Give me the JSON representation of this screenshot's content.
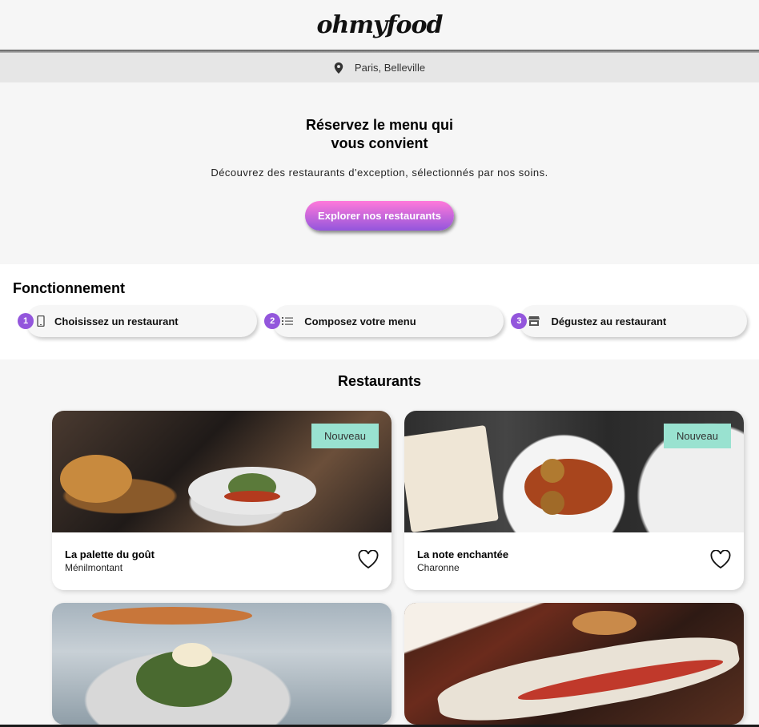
{
  "header": {
    "logo": "ohmyfood"
  },
  "location": {
    "text": "Paris, Belleville"
  },
  "hero": {
    "title_line1": "Réservez le menu qui",
    "title_line2": "vous convient",
    "subtitle": "Découvrez des restaurants d'exception, sélectionnés par nos soins.",
    "cta_label": "Explorer nos restaurants"
  },
  "how": {
    "title": "Fonctionnement",
    "steps": [
      {
        "number": "1",
        "icon": "mobile-phone-icon",
        "label": "Choisissez un restaurant"
      },
      {
        "number": "2",
        "icon": "list-icon",
        "label": "Composez votre menu"
      },
      {
        "number": "3",
        "icon": "store-icon",
        "label": "Dégustez au restaurant"
      }
    ]
  },
  "restaurants": {
    "title": "Restaurants",
    "items": [
      {
        "name": "La palette du goût",
        "area": "Ménilmontant",
        "badge": "Nouveau"
      },
      {
        "name": "La note enchantée",
        "area": "Charonne",
        "badge": "Nouveau"
      },
      {
        "name": "",
        "area": "",
        "badge": ""
      },
      {
        "name": "",
        "area": "",
        "badge": ""
      }
    ]
  },
  "colors": {
    "accent_purple": "#9356dc",
    "cta_pink": "#ff79da",
    "badge_green": "#99e2d0"
  }
}
